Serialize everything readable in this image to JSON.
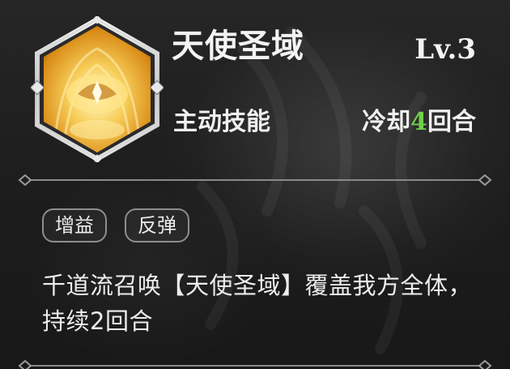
{
  "skill": {
    "name": "天使圣域",
    "level": "Lv.3",
    "type": "主动技能",
    "cooldown_prefix": "冷却",
    "cooldown_value": "4",
    "cooldown_suffix": "回合",
    "tags": [
      "增益",
      "反弹"
    ],
    "description": "千道流召唤【天使圣域】覆盖我方全体，持续2回合"
  },
  "colors": {
    "cooldown_value": "#6fd14a",
    "icon_gold": "#f1b32c",
    "tag_border": "#8d8d8d"
  },
  "icons": {
    "skill_icon": "golden-angel-halo-icon"
  }
}
